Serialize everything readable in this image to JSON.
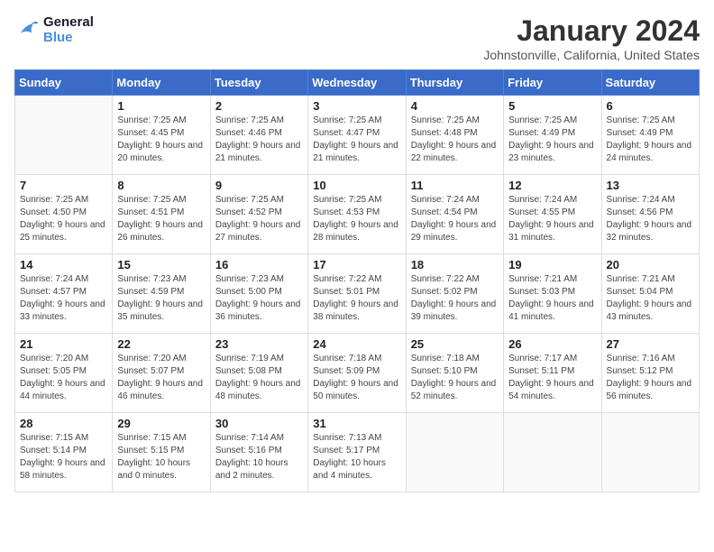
{
  "header": {
    "logo_line1": "General",
    "logo_line2": "Blue",
    "month": "January 2024",
    "location": "Johnstonville, California, United States"
  },
  "days_of_week": [
    "Sunday",
    "Monday",
    "Tuesday",
    "Wednesday",
    "Thursday",
    "Friday",
    "Saturday"
  ],
  "weeks": [
    [
      {
        "day": "",
        "sunrise": "",
        "sunset": "",
        "daylight": ""
      },
      {
        "day": "1",
        "sunrise": "7:25 AM",
        "sunset": "4:45 PM",
        "daylight": "9 hours and 20 minutes."
      },
      {
        "day": "2",
        "sunrise": "7:25 AM",
        "sunset": "4:46 PM",
        "daylight": "9 hours and 21 minutes."
      },
      {
        "day": "3",
        "sunrise": "7:25 AM",
        "sunset": "4:47 PM",
        "daylight": "9 hours and 21 minutes."
      },
      {
        "day": "4",
        "sunrise": "7:25 AM",
        "sunset": "4:48 PM",
        "daylight": "9 hours and 22 minutes."
      },
      {
        "day": "5",
        "sunrise": "7:25 AM",
        "sunset": "4:49 PM",
        "daylight": "9 hours and 23 minutes."
      },
      {
        "day": "6",
        "sunrise": "7:25 AM",
        "sunset": "4:49 PM",
        "daylight": "9 hours and 24 minutes."
      }
    ],
    [
      {
        "day": "7",
        "sunrise": "7:25 AM",
        "sunset": "4:50 PM",
        "daylight": "9 hours and 25 minutes."
      },
      {
        "day": "8",
        "sunrise": "7:25 AM",
        "sunset": "4:51 PM",
        "daylight": "9 hours and 26 minutes."
      },
      {
        "day": "9",
        "sunrise": "7:25 AM",
        "sunset": "4:52 PM",
        "daylight": "9 hours and 27 minutes."
      },
      {
        "day": "10",
        "sunrise": "7:25 AM",
        "sunset": "4:53 PM",
        "daylight": "9 hours and 28 minutes."
      },
      {
        "day": "11",
        "sunrise": "7:24 AM",
        "sunset": "4:54 PM",
        "daylight": "9 hours and 29 minutes."
      },
      {
        "day": "12",
        "sunrise": "7:24 AM",
        "sunset": "4:55 PM",
        "daylight": "9 hours and 31 minutes."
      },
      {
        "day": "13",
        "sunrise": "7:24 AM",
        "sunset": "4:56 PM",
        "daylight": "9 hours and 32 minutes."
      }
    ],
    [
      {
        "day": "14",
        "sunrise": "7:24 AM",
        "sunset": "4:57 PM",
        "daylight": "9 hours and 33 minutes."
      },
      {
        "day": "15",
        "sunrise": "7:23 AM",
        "sunset": "4:59 PM",
        "daylight": "9 hours and 35 minutes."
      },
      {
        "day": "16",
        "sunrise": "7:23 AM",
        "sunset": "5:00 PM",
        "daylight": "9 hours and 36 minutes."
      },
      {
        "day": "17",
        "sunrise": "7:22 AM",
        "sunset": "5:01 PM",
        "daylight": "9 hours and 38 minutes."
      },
      {
        "day": "18",
        "sunrise": "7:22 AM",
        "sunset": "5:02 PM",
        "daylight": "9 hours and 39 minutes."
      },
      {
        "day": "19",
        "sunrise": "7:21 AM",
        "sunset": "5:03 PM",
        "daylight": "9 hours and 41 minutes."
      },
      {
        "day": "20",
        "sunrise": "7:21 AM",
        "sunset": "5:04 PM",
        "daylight": "9 hours and 43 minutes."
      }
    ],
    [
      {
        "day": "21",
        "sunrise": "7:20 AM",
        "sunset": "5:05 PM",
        "daylight": "9 hours and 44 minutes."
      },
      {
        "day": "22",
        "sunrise": "7:20 AM",
        "sunset": "5:07 PM",
        "daylight": "9 hours and 46 minutes."
      },
      {
        "day": "23",
        "sunrise": "7:19 AM",
        "sunset": "5:08 PM",
        "daylight": "9 hours and 48 minutes."
      },
      {
        "day": "24",
        "sunrise": "7:18 AM",
        "sunset": "5:09 PM",
        "daylight": "9 hours and 50 minutes."
      },
      {
        "day": "25",
        "sunrise": "7:18 AM",
        "sunset": "5:10 PM",
        "daylight": "9 hours and 52 minutes."
      },
      {
        "day": "26",
        "sunrise": "7:17 AM",
        "sunset": "5:11 PM",
        "daylight": "9 hours and 54 minutes."
      },
      {
        "day": "27",
        "sunrise": "7:16 AM",
        "sunset": "5:12 PM",
        "daylight": "9 hours and 56 minutes."
      }
    ],
    [
      {
        "day": "28",
        "sunrise": "7:15 AM",
        "sunset": "5:14 PM",
        "daylight": "9 hours and 58 minutes."
      },
      {
        "day": "29",
        "sunrise": "7:15 AM",
        "sunset": "5:15 PM",
        "daylight": "10 hours and 0 minutes."
      },
      {
        "day": "30",
        "sunrise": "7:14 AM",
        "sunset": "5:16 PM",
        "daylight": "10 hours and 2 minutes."
      },
      {
        "day": "31",
        "sunrise": "7:13 AM",
        "sunset": "5:17 PM",
        "daylight": "10 hours and 4 minutes."
      },
      {
        "day": "",
        "sunrise": "",
        "sunset": "",
        "daylight": ""
      },
      {
        "day": "",
        "sunrise": "",
        "sunset": "",
        "daylight": ""
      },
      {
        "day": "",
        "sunrise": "",
        "sunset": "",
        "daylight": ""
      }
    ]
  ]
}
